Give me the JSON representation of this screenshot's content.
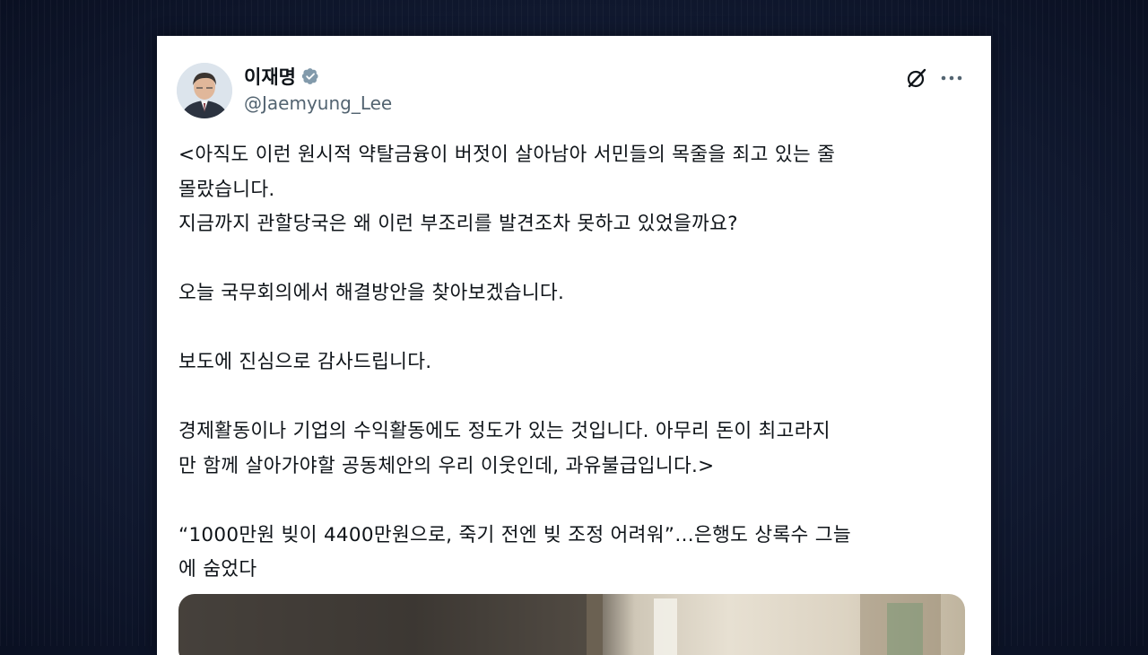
{
  "author": {
    "display_name": "이재명",
    "handle": "@Jaemyung_Lee",
    "verified": true
  },
  "icons": {
    "avatar": "profile-photo",
    "verified": "verified-badge-icon",
    "grok": "grok-icon",
    "more": "more-options-icon"
  },
  "colors": {
    "background": "#121b33",
    "card": "#ffffff",
    "text": "#0f1419",
    "handle": "#536471",
    "verified_badge": "#829aab"
  },
  "tweet": {
    "lines": [
      "<아직도 이런 원시적 약탈금융이 버젓이 살아남아 서민들의 목줄을 죄고 있는 줄",
      "몰랐습니다.",
      "지금까지 관할당국은 왜 이런 부조리를 발견조차 못하고 있었을까요?",
      "",
      "오늘 국무회의에서 해결방안을 찾아보겠습니다.",
      "",
      "보도에 진심으로 감사드립니다.",
      "",
      "경제활동이나 기업의 수익활동에도 정도가 있는 것입니다. 아무리 돈이 최고라지",
      "만 함께 살아가야할 공동체안의 우리 이웃인데, 과유불급입니다.>",
      "",
      "“1000만원 빚이 4400만원으로, 죽기 전엔 빚 조정 어려워”…은행도 상록수 그늘",
      "에 숨었다"
    ]
  }
}
